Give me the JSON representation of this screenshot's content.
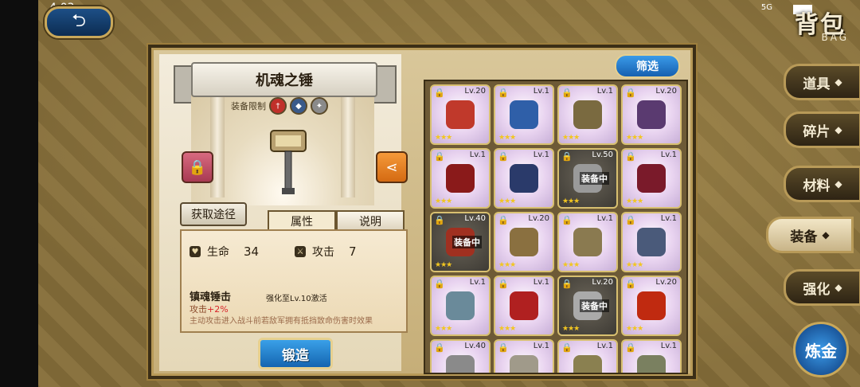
{
  "status": {
    "time": "4:03",
    "network": "5G"
  },
  "header": {
    "title": "背包",
    "subtitle": "BAG",
    "back_icon": "back-arrow-icon"
  },
  "detail": {
    "item_name": "机魂之锤",
    "restriction_label": "装备限制",
    "source_button": "获取途径",
    "tabs": [
      "属性",
      "说明"
    ],
    "stats": [
      {
        "label": "生命",
        "value": "34"
      },
      {
        "label": "攻击",
        "value": "7"
      }
    ],
    "skill": {
      "title": "镇魂锤击",
      "condition": "强化至Lv.10激活",
      "attr_prefix": "攻击",
      "attr_value": "+2%",
      "description": "主动攻击进入战斗前若敌军拥有抵挡致命伤害时效果"
    },
    "forge_button": "锻造"
  },
  "filter_button": "筛选",
  "grid": [
    {
      "level": "Lv.20",
      "equipped": false,
      "dark": false,
      "color": "#c0392b"
    },
    {
      "level": "Lv.1",
      "equipped": false,
      "dark": false,
      "color": "#2f5fa8"
    },
    {
      "level": "Lv.1",
      "equipped": false,
      "dark": false,
      "color": "#7a6a40"
    },
    {
      "level": "Lv.20",
      "equipped": false,
      "dark": false,
      "color": "#5a3a70"
    },
    {
      "level": "Lv.1",
      "equipped": false,
      "dark": false,
      "color": "#8a1a1a"
    },
    {
      "level": "Lv.1",
      "equipped": false,
      "dark": false,
      "color": "#2a3a6a"
    },
    {
      "level": "Lv.50",
      "equipped": true,
      "dark": true,
      "color": "#9a9a9a"
    },
    {
      "level": "Lv.1",
      "equipped": false,
      "dark": false,
      "color": "#7a1a2a"
    },
    {
      "level": "Lv.40",
      "equipped": true,
      "dark": true,
      "color": "#a03020"
    },
    {
      "level": "Lv.20",
      "equipped": false,
      "dark": false,
      "color": "#8a7040"
    },
    {
      "level": "Lv.1",
      "equipped": false,
      "dark": false,
      "color": "#8a7a50"
    },
    {
      "level": "Lv.1",
      "equipped": false,
      "dark": false,
      "color": "#4a5a7a"
    },
    {
      "level": "Lv.1",
      "equipped": false,
      "dark": false,
      "color": "#6a8a9a"
    },
    {
      "level": "Lv.1",
      "equipped": false,
      "dark": false,
      "color": "#b02020"
    },
    {
      "level": "Lv.20",
      "equipped": true,
      "dark": true,
      "color": "#aaaaaa"
    },
    {
      "level": "Lv.20",
      "equipped": false,
      "dark": false,
      "color": "#c02a10"
    },
    {
      "level": "Lv.40",
      "equipped": false,
      "dark": false,
      "color": "#8a8a8a"
    },
    {
      "level": "Lv.1",
      "equipped": false,
      "dark": false,
      "color": "#a09a8a"
    },
    {
      "level": "Lv.1",
      "equipped": false,
      "dark": false,
      "color": "#8a8050"
    },
    {
      "level": "Lv.1",
      "equipped": false,
      "dark": false,
      "color": "#7a8060"
    }
  ],
  "equipped_label": "装备中",
  "side_tabs": [
    {
      "label": "道具",
      "icon": "flask-icon",
      "active": false
    },
    {
      "label": "碎片",
      "icon": "shard-icon",
      "active": false
    },
    {
      "label": "材料",
      "icon": "bag-icon",
      "active": false
    },
    {
      "label": "装备",
      "icon": "armor-icon",
      "active": true
    },
    {
      "label": "强化",
      "icon": "upgrade-icon",
      "active": false
    }
  ],
  "alchemy_button": "炼金"
}
